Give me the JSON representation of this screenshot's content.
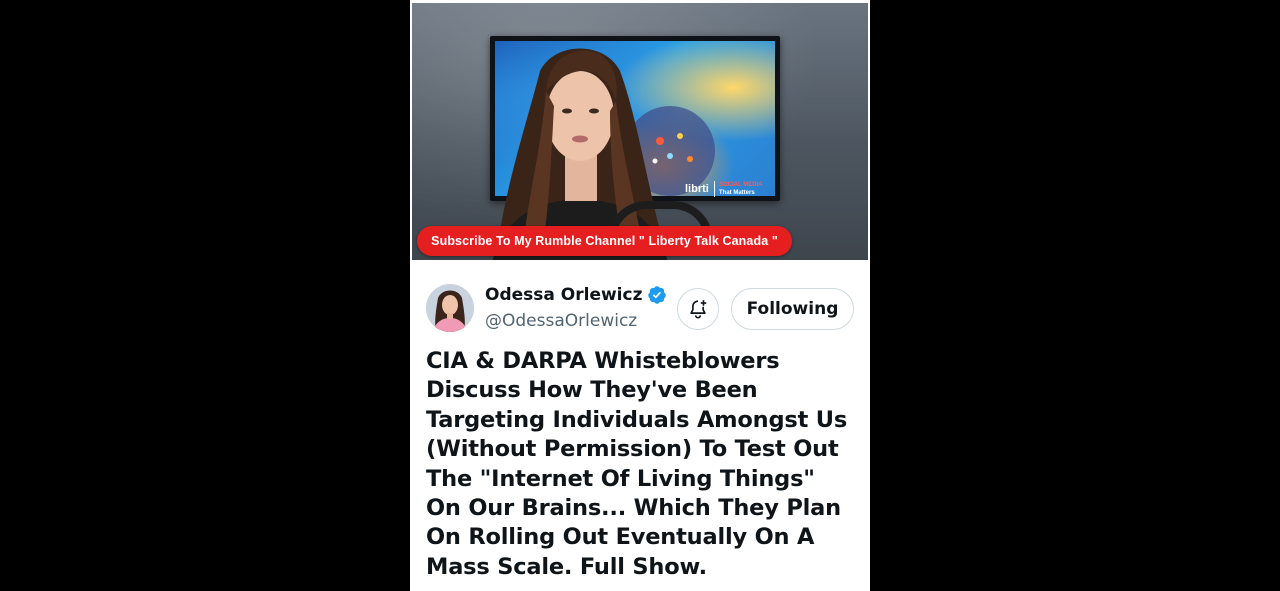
{
  "video": {
    "banner_text": "Subscribe To My Rumble Channel \" Liberty Talk Canada \"",
    "tv_brand": "librti",
    "tv_tagline_1": "SOCIAL MEDIA",
    "tv_tagline_2": "That Matters"
  },
  "author": {
    "name": "Odessa Orlewicz",
    "handle": "@OdessaOrlewicz",
    "verified": true,
    "verified_color": "#1d9bf0"
  },
  "actions": {
    "notification_icon": "bell-plus-icon",
    "follow_label": "Following"
  },
  "post": {
    "text": "CIA & DARPA Whisteblowers Discuss How They've Been Targeting Individuals Amongst Us (Without Permission) To Test Out The \"Internet Of Living Things\" On Our Brains... Which They Plan On Rolling Out Eventually On A Mass Scale. Full Show."
  },
  "colors": {
    "background": "#000000",
    "panel": "#ffffff",
    "banner": "#e51f1f",
    "text_primary": "#0f1419",
    "text_secondary": "#536471"
  }
}
